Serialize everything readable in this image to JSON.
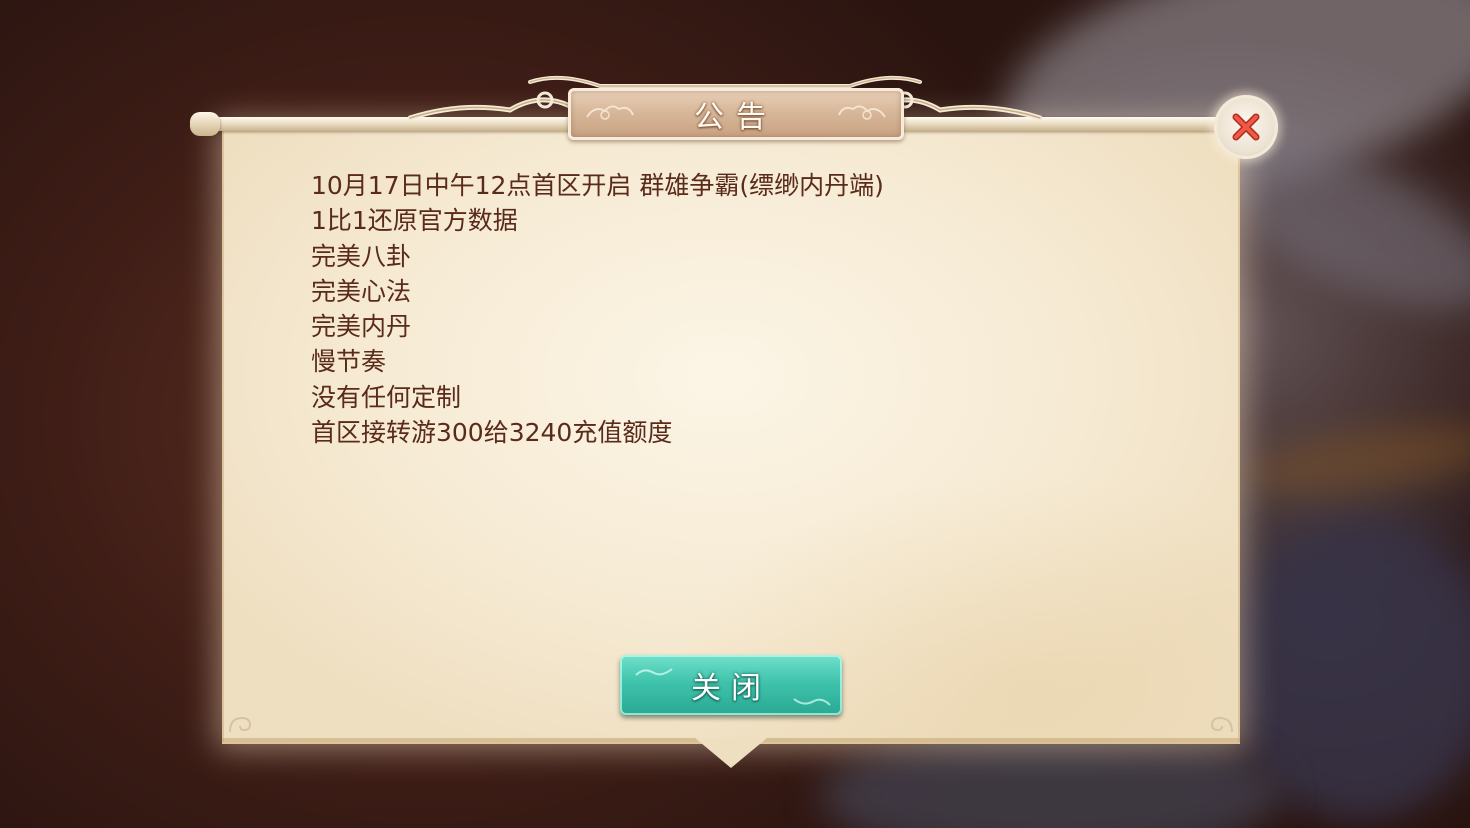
{
  "dialog": {
    "title": "公告",
    "lines": [
      "10月17日中午12点首区开启 群雄争霸(缥缈内丹端)",
      "1比1还原官方数据",
      "完美八卦",
      "完美心法",
      "完美内丹",
      "慢节奏",
      "没有任何定制",
      "首区接转游300给3240充值额度"
    ],
    "close_button_label": "关闭",
    "close_icon": "close-x-icon"
  },
  "colors": {
    "text": "#5a2a1a",
    "close_icon": "#e0453a",
    "button": "#3fc3ac",
    "parchment": "#f6ead3"
  }
}
